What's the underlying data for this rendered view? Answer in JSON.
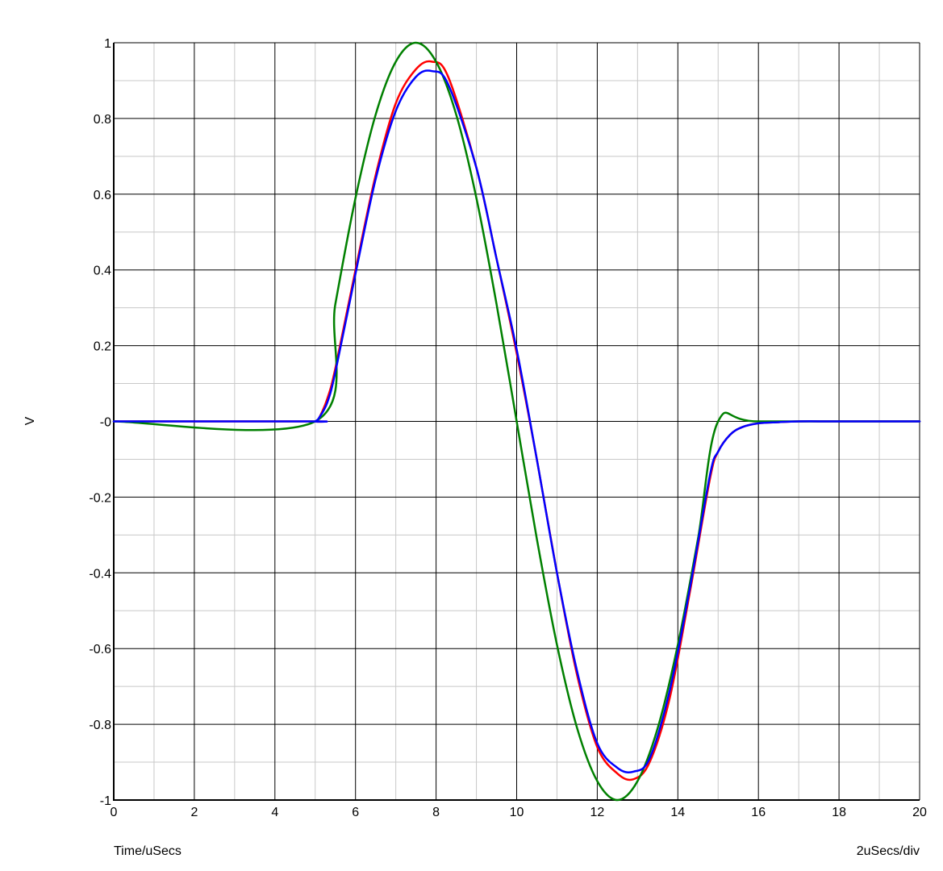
{
  "chart_data": {
    "type": "line",
    "xlabel": "Time/uSecs",
    "ylabel": "V",
    "scale_label": "2uSecs/div",
    "xlim": [
      0,
      20
    ],
    "ylim": [
      -1,
      1
    ],
    "x_ticks": [
      {
        "value": 0,
        "label": "0"
      },
      {
        "value": 2,
        "label": "2"
      },
      {
        "value": 4,
        "label": "4"
      },
      {
        "value": 6,
        "label": "6"
      },
      {
        "value": 8,
        "label": "8"
      },
      {
        "value": 10,
        "label": "10"
      },
      {
        "value": 12,
        "label": "12"
      },
      {
        "value": 14,
        "label": "14"
      },
      {
        "value": 16,
        "label": "16"
      },
      {
        "value": 18,
        "label": "18"
      },
      {
        "value": 20,
        "label": "20"
      }
    ],
    "y_ticks": [
      {
        "value": 1,
        "label": "1"
      },
      {
        "value": 0.8,
        "label": "0.8"
      },
      {
        "value": 0.6,
        "label": "0.6"
      },
      {
        "value": 0.4,
        "label": "0.4"
      },
      {
        "value": 0.2,
        "label": "0.2"
      },
      {
        "value": 0,
        "label": "-0"
      },
      {
        "value": -0.2,
        "label": "-0.2"
      },
      {
        "value": -0.4,
        "label": "-0.4"
      },
      {
        "value": -0.6,
        "label": "-0.6"
      },
      {
        "value": -0.8,
        "label": "-0.8"
      },
      {
        "value": -1,
        "label": "-1"
      }
    ],
    "grid": true,
    "series": [
      {
        "color": "#ff0000",
        "x": [
          0,
          4.9,
          5.0,
          5.1,
          5.3,
          5.5,
          6.0,
          6.5,
          7.0,
          7.5,
          7.9,
          8.3,
          9.0,
          9.5,
          10.0,
          10.5,
          11.0,
          11.5,
          12.0,
          12.5,
          12.9,
          13.3,
          13.8,
          14.3,
          14.8,
          15.0,
          15.3,
          15.6,
          16.0,
          16.5,
          17.0,
          18.0,
          20.0
        ],
        "y": [
          0,
          0,
          0,
          0.01,
          0.06,
          0.14,
          0.4,
          0.65,
          0.84,
          0.93,
          0.95,
          0.91,
          0.67,
          0.43,
          0.18,
          -0.1,
          -0.4,
          -0.67,
          -0.86,
          -0.93,
          -0.945,
          -0.9,
          -0.73,
          -0.45,
          -0.15,
          -0.08,
          -0.035,
          -0.015,
          -0.005,
          -0.002,
          0,
          0,
          0
        ]
      },
      {
        "color": "#0000ff",
        "x": [
          0,
          4.9,
          5.0,
          5.1,
          5.3,
          5.5,
          6.0,
          6.5,
          7.0,
          7.5,
          7.9,
          8.3,
          9.0,
          9.5,
          10.0,
          10.5,
          11.0,
          11.5,
          12.0,
          12.5,
          12.9,
          13.3,
          13.8,
          14.3,
          14.8,
          15.0,
          15.3,
          15.6,
          16.0,
          16.5,
          17.0,
          18.0,
          20.0
        ],
        "y": [
          0,
          0,
          0,
          0.01,
          0.05,
          0.13,
          0.39,
          0.64,
          0.82,
          0.91,
          0.925,
          0.89,
          0.67,
          0.43,
          0.19,
          -0.1,
          -0.4,
          -0.66,
          -0.85,
          -0.915,
          -0.925,
          -0.89,
          -0.71,
          -0.44,
          -0.14,
          -0.08,
          -0.035,
          -0.015,
          -0.005,
          -0.002,
          0,
          0,
          0
        ]
      },
      {
        "color": "#008000",
        "x": [
          0,
          5.0,
          5.5,
          6.0,
          6.5,
          7.0,
          7.5,
          8.0,
          8.5,
          9.0,
          9.5,
          10.0,
          10.5,
          11.0,
          11.5,
          12.0,
          12.5,
          13.0,
          13.5,
          14.0,
          14.5,
          15.0,
          16.0,
          20.0
        ],
        "y": [
          0,
          0,
          0.31,
          0.59,
          0.81,
          0.95,
          1.0,
          0.95,
          0.81,
          0.59,
          0.31,
          0,
          -0.31,
          -0.59,
          -0.81,
          -0.95,
          -1.0,
          -0.95,
          -0.81,
          -0.59,
          -0.31,
          0,
          0,
          0
        ]
      }
    ]
  }
}
